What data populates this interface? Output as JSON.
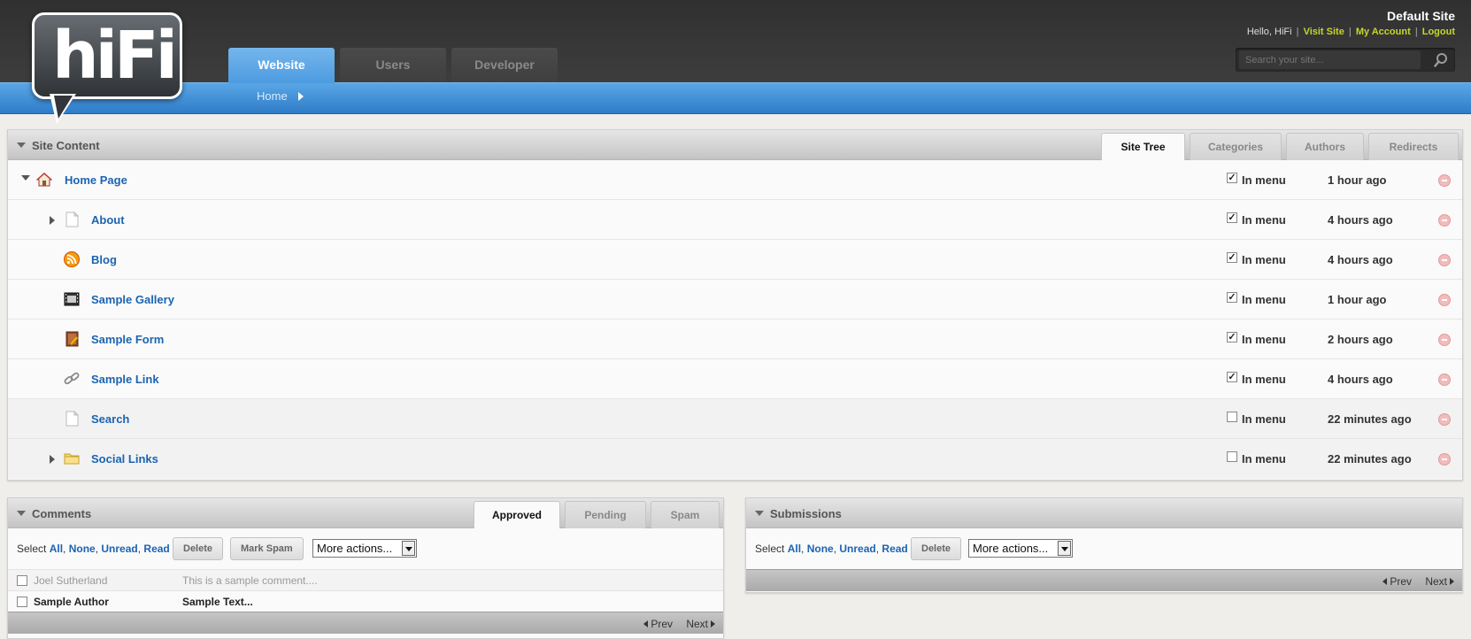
{
  "header": {
    "logo_text": "hiFi",
    "site_title": "Default Site",
    "greeting": "Hello, HiFi",
    "links": {
      "visit": "Visit Site",
      "account": "My Account",
      "logout": "Logout"
    },
    "search_placeholder": "Search your site..."
  },
  "nav": {
    "tabs": [
      {
        "label": "Website",
        "active": true
      },
      {
        "label": "Users",
        "active": false
      },
      {
        "label": "Developer",
        "active": false
      }
    ],
    "breadcrumb": "Home"
  },
  "site_content": {
    "title": "Site Content",
    "tabs": [
      "Site Tree",
      "Categories",
      "Authors",
      "Redirects"
    ],
    "in_menu_label": "In menu",
    "rows": [
      {
        "name": "Home Page",
        "icon": "home-icon",
        "in_menu": true,
        "updated": "1 hour ago"
      },
      {
        "name": "About",
        "icon": "page-icon",
        "in_menu": true,
        "updated": "4 hours ago"
      },
      {
        "name": "Blog",
        "icon": "rss-icon",
        "in_menu": true,
        "updated": "4 hours ago"
      },
      {
        "name": "Sample Gallery",
        "icon": "film-icon",
        "in_menu": true,
        "updated": "1 hour ago"
      },
      {
        "name": "Sample Form",
        "icon": "form-icon",
        "in_menu": true,
        "updated": "2 hours ago"
      },
      {
        "name": "Sample Link",
        "icon": "link-icon",
        "in_menu": true,
        "updated": "4 hours ago"
      },
      {
        "name": "Search",
        "icon": "page-icon",
        "in_menu": false,
        "updated": "22 minutes ago"
      },
      {
        "name": "Social Links",
        "icon": "folder-icon",
        "in_menu": false,
        "updated": "22 minutes ago"
      }
    ]
  },
  "comments": {
    "title": "Comments",
    "tabs": [
      "Approved",
      "Pending",
      "Spam"
    ],
    "select_label": "Select",
    "select_links": [
      "All",
      "None",
      "Unread",
      "Read"
    ],
    "delete_label": "Delete",
    "spam_label": "Mark Spam",
    "more_actions": "More actions...",
    "rows": [
      {
        "author": "Joel Sutherland",
        "text": "This is a sample comment...."
      },
      {
        "author": "Sample Author",
        "text": "Sample Text..."
      }
    ],
    "prev": "Prev",
    "next": "Next"
  },
  "submissions": {
    "title": "Submissions",
    "select_label": "Select",
    "select_links": [
      "All",
      "None",
      "Unread",
      "Read"
    ],
    "delete_label": "Delete",
    "more_actions": "More actions...",
    "prev": "Prev",
    "next": "Next"
  },
  "colors": {
    "link_blue": "#1b64b2",
    "header_dark": "#333333",
    "bar_blue": "#3b8bd6",
    "header_link": "#c6d62a"
  }
}
